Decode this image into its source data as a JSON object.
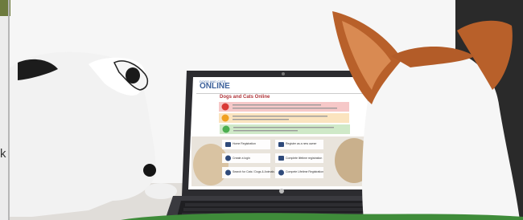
{
  "screen": {
    "brand_prefix": "DOGS AND CATS",
    "brand": "ONLINE",
    "page_title": "Dogs and Cats Online",
    "rows": [
      {
        "num": "1",
        "color": "#d93a36"
      },
      {
        "num": "2",
        "color": "#f0a122"
      },
      {
        "num": "3",
        "color": "#4caf50"
      }
    ],
    "tiles": [
      {
        "label": "Home Registration",
        "icon": "id-card-icon"
      },
      {
        "label": "Register as a new owner",
        "icon": "paw-card-icon"
      },
      {
        "label": "Create a login",
        "icon": "user-icon"
      },
      {
        "label": "Complete lifetime registration",
        "icon": "doc-icon"
      },
      {
        "label": "Search for Cats / Dogs & Animals",
        "icon": "search-icon"
      },
      {
        "label": "Compete Lifetime Registration",
        "icon": "gear-icon"
      }
    ]
  },
  "side_text": "k",
  "colors": {
    "wall": "#efefef",
    "laptop": "#4a4a4f",
    "dog_left_patch": "#1c1c1c",
    "dog_right_patch": "#b8602a",
    "grass": "#3f8c3a"
  }
}
